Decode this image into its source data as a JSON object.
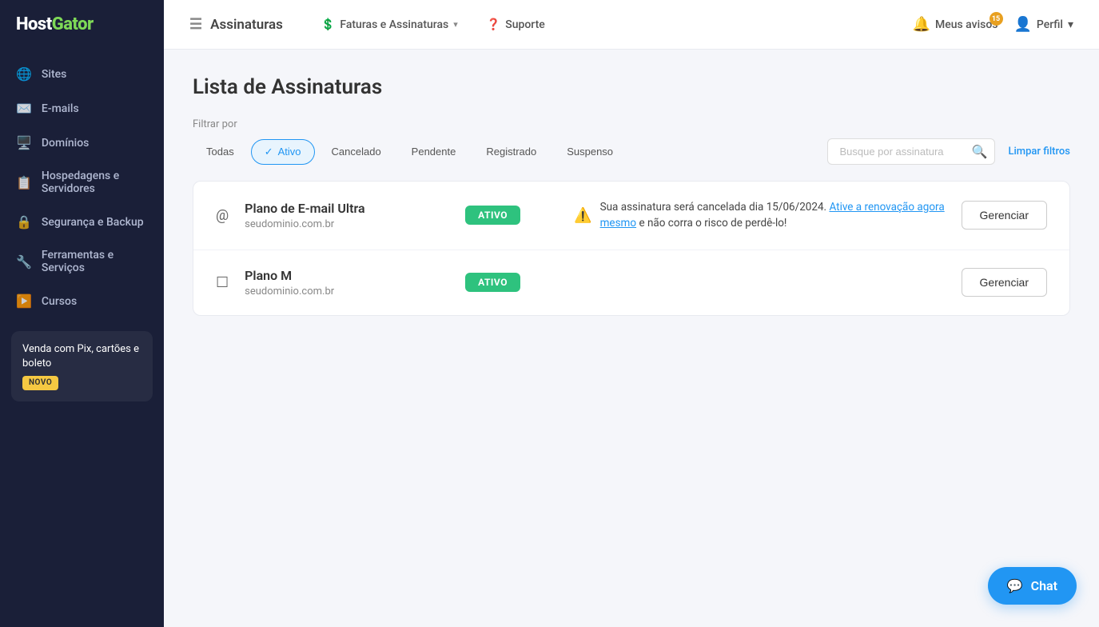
{
  "sidebar": {
    "logo": "HostGator",
    "items": [
      {
        "id": "sites",
        "label": "Sites",
        "icon": "🌐"
      },
      {
        "id": "emails",
        "label": "E-mails",
        "icon": "✉️"
      },
      {
        "id": "dominios",
        "label": "Domínios",
        "icon": "🖥️"
      },
      {
        "id": "hospedagens",
        "label": "Hospedagens e Servidores",
        "icon": "📋"
      },
      {
        "id": "seguranca",
        "label": "Segurança e Backup",
        "icon": "🔒"
      },
      {
        "id": "ferramentas",
        "label": "Ferramentas e Serviços",
        "icon": "🔧"
      },
      {
        "id": "cursos",
        "label": "Cursos",
        "icon": "▶️"
      }
    ],
    "promo": {
      "text": "Venda com Pix, cartões e boleto",
      "badge": "NOVO"
    }
  },
  "topbar": {
    "title": "Assinaturas",
    "title_icon": "☰",
    "nav_items": [
      {
        "id": "faturas",
        "label": "Faturas e Assinaturas",
        "icon": "💲",
        "has_chevron": true
      },
      {
        "id": "suporte",
        "label": "Suporte",
        "icon": "❓"
      }
    ],
    "notifications": {
      "label": "Meus avisos",
      "badge_count": "15"
    },
    "profile": {
      "label": "Perfil",
      "has_chevron": true
    }
  },
  "page": {
    "title": "Lista de Assinaturas",
    "filter_label": "Filtrar por",
    "filters": [
      {
        "id": "todas",
        "label": "Todas",
        "active": false
      },
      {
        "id": "ativo",
        "label": "Ativo",
        "active": true
      },
      {
        "id": "cancelado",
        "label": "Cancelado",
        "active": false
      },
      {
        "id": "pendente",
        "label": "Pendente",
        "active": false
      },
      {
        "id": "registrado",
        "label": "Registrado",
        "active": false
      },
      {
        "id": "suspenso",
        "label": "Suspenso",
        "active": false
      }
    ],
    "search_placeholder": "Busque por assinatura",
    "clear_filters": "Limpar filtros"
  },
  "subscriptions": [
    {
      "id": "sub1",
      "icon": "@",
      "name": "Plano de E-mail Ultra",
      "domain": "seudominio.com.br",
      "status": "ATIVO",
      "has_alert": true,
      "alert_text_before": "Sua assinatura será cancelada dia 15/06/2024.",
      "alert_link_text": "Ative a renovação agora mesmo",
      "alert_text_after": "e não corra o risco de perdê-lo!",
      "manage_label": "Gerenciar"
    },
    {
      "id": "sub2",
      "icon": "☐",
      "name": "Plano M",
      "domain": "seudominio.com.br",
      "status": "ATIVO",
      "has_alert": false,
      "manage_label": "Gerenciar"
    }
  ],
  "chat": {
    "label": "Chat"
  }
}
